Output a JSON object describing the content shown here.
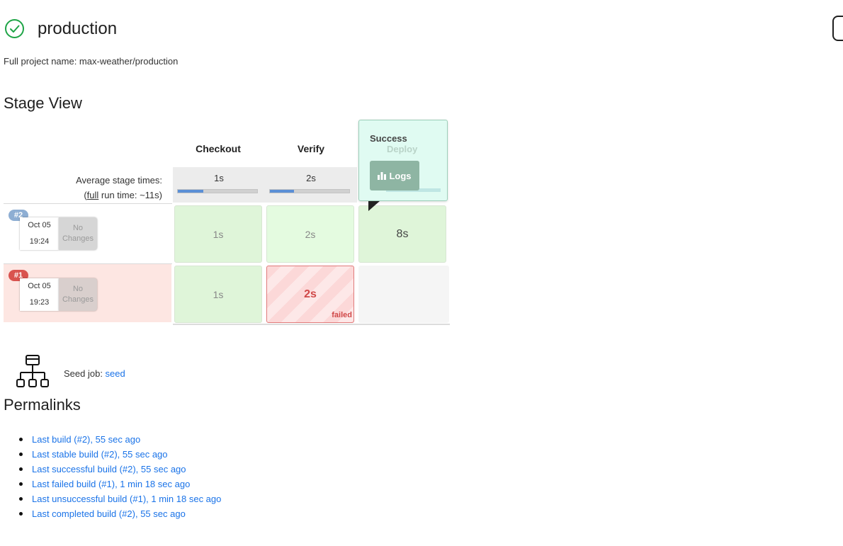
{
  "header": {
    "title": "production",
    "status_icon": "check-circle-icon",
    "full_name": "Full project name: max-weather/production"
  },
  "stage_view": {
    "heading": "Stage View",
    "avg_label_line1": "Average stage times:",
    "avg_label_prefix": "(",
    "avg_label_link": "full",
    "avg_label_suffix": " run time: ~11s)",
    "columns": [
      {
        "name": "Checkout",
        "avg": "1s",
        "avg_fraction": 0.32
      },
      {
        "name": "Verify",
        "avg": "2s",
        "avg_fraction": 0.3
      },
      {
        "name": "Deploy",
        "avg": "",
        "avg_fraction": 1.0
      }
    ],
    "builds": [
      {
        "badge": "#2",
        "date": "Oct 05",
        "time": "19:24",
        "changes": "No Changes",
        "cells": [
          "1s",
          "2s",
          "8s"
        ]
      },
      {
        "badge": "#1",
        "date": "Oct 05",
        "time": "19:23",
        "changes": "No Changes",
        "cells": [
          "1s",
          "2s",
          ""
        ],
        "failed_label": "failed"
      }
    ],
    "tooltip": {
      "title": "Success",
      "ghost_title": "Deploy",
      "logs_label": "Logs",
      "logs_icon": "bar-chart-icon"
    },
    "colors": {
      "success": "#dff5d9",
      "failed": "#d04848",
      "badge_ok": "#8eaed3",
      "badge_fail": "#d9534f"
    }
  },
  "seed": {
    "label": "Seed job: ",
    "link": "seed",
    "icon": "hierarchy-icon"
  },
  "permalinks": {
    "heading": "Permalinks",
    "items": [
      "Last build (#2), 55 sec ago",
      "Last stable build (#2), 55 sec ago",
      "Last successful build (#2), 55 sec ago",
      "Last failed build (#1), 1 min 18 sec ago",
      "Last unsuccessful build (#1), 1 min 18 sec ago",
      "Last completed build (#2), 55 sec ago"
    ]
  }
}
